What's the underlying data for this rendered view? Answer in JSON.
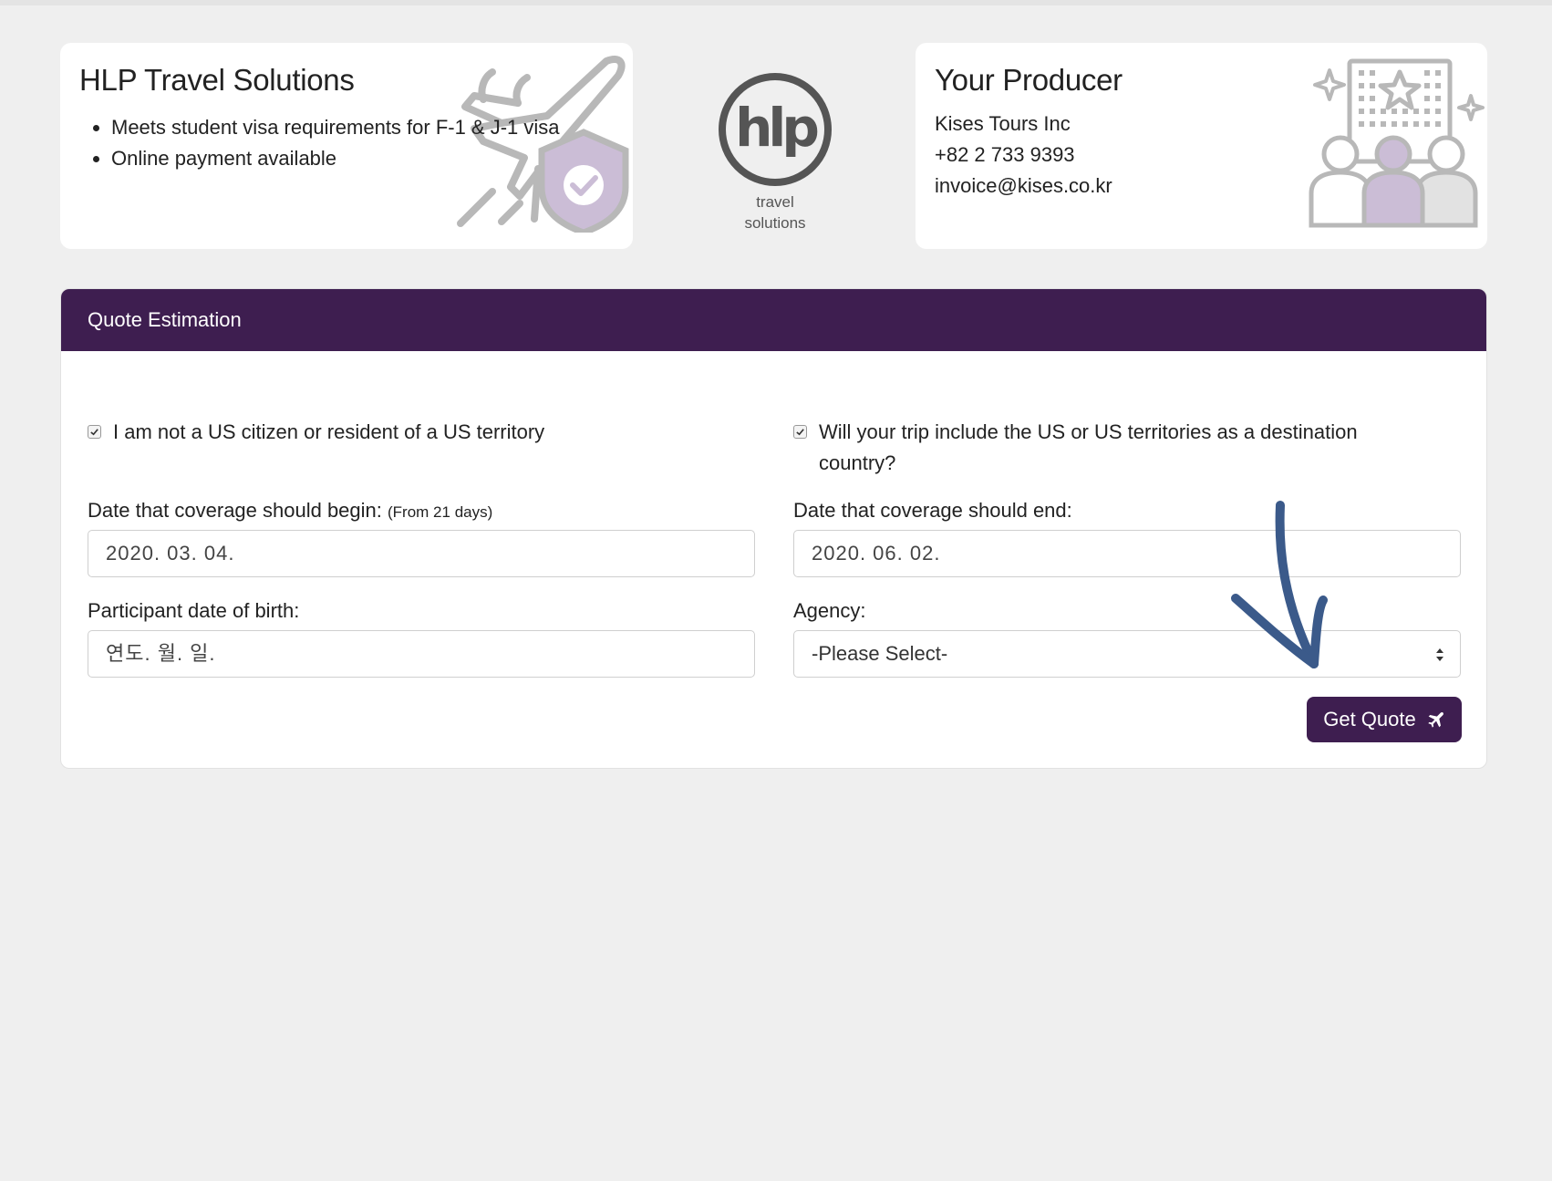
{
  "info_card": {
    "title": "HLP Travel Solutions",
    "bullets": [
      "Meets student visa requirements for F-1 & J-1 visa",
      "Online payment available"
    ]
  },
  "logo": {
    "mark": "hlp",
    "line1": "travel",
    "line2": "solutions"
  },
  "producer_card": {
    "title": "Your Producer",
    "company": "Kises Tours Inc",
    "phone": "+82 2 733 9393",
    "email": "invoice@kises.co.kr"
  },
  "quote_panel": {
    "header": "Quote Estimation",
    "checkbox_not_us_citizen": {
      "label": "I am not a US citizen or resident of a US territory",
      "checked": true
    },
    "checkbox_us_destination": {
      "label": "Will your trip include the US or US territories as a destination country?",
      "checked": true
    },
    "coverage_begin": {
      "label": "Date that coverage should begin:",
      "hint": "(From 21 days)",
      "value": "2020. 03. 04."
    },
    "coverage_end": {
      "label": "Date that coverage should end:",
      "value": "2020. 06. 02."
    },
    "birth_date": {
      "label": "Participant date of birth:",
      "placeholder": "연도. 월. 일."
    },
    "agency": {
      "label": "Agency:",
      "selected": "-Please Select-"
    },
    "submit_label": "Get Quote"
  },
  "colors": {
    "brand_purple": "#3e1e50",
    "illustration_lavender": "#cbbdd6",
    "annotation_arrow": "#3b5a8a"
  }
}
